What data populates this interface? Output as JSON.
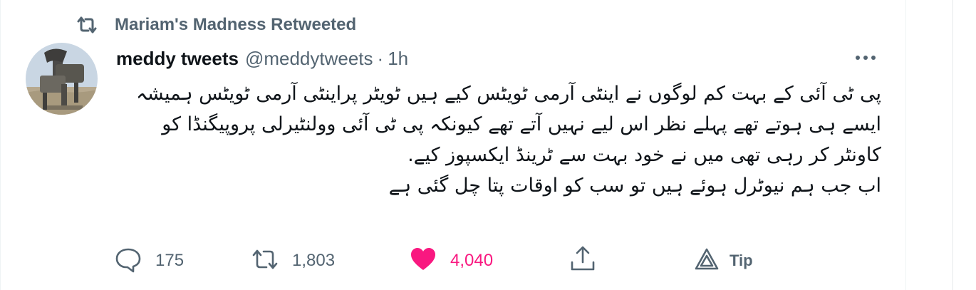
{
  "context": {
    "retweet_label": "Mariam's Madness Retweeted"
  },
  "tweet": {
    "author_name": "meddy tweets",
    "handle": "@meddytweets",
    "separator": "·",
    "time": "1h",
    "text_paragraph_1": "پی ٹی آئی کے بہت کم لوگوں نے اینٹی آرمی ٹویٹس کیے ہیں ٹویٹر پراینٹی آرمی ٹویٹس ہمیشہ ایسے ہی ہوتے تھے پہلے نظر اس لیے نہیں آتے تھے کیونکہ پی ٹی آئی وولنٹیرلی پروپیگنڈا کو کاونٹر کر رہی تھی میں نے خود بہت سے ٹرینڈ ایکسپوز کیے.",
    "text_paragraph_2": "اب جب ہم نیوٹرل ہوئے ہیں تو سب کو اوقات پتا چل گئی ہے"
  },
  "actions": {
    "reply_count": "175",
    "retweet_count": "1,803",
    "like_count": "4,040",
    "tip_label": "Tip"
  },
  "colors": {
    "secondary_text": "#536471",
    "primary_text": "#0f1419",
    "like_pink": "#f91880",
    "border": "#eff3f4"
  },
  "icons": [
    "retweet-icon",
    "more-icon",
    "reply-icon",
    "retweet-icon",
    "heart-icon",
    "share-icon",
    "tip-icon"
  ]
}
